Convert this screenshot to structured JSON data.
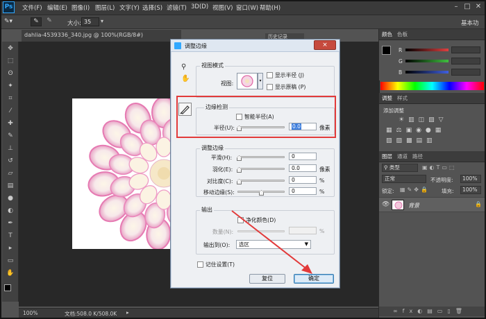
{
  "app": {
    "logo": "Ps"
  },
  "menubar": {
    "items": [
      "文件(F)",
      "编辑(E)",
      "图像(I)",
      "图层(L)",
      "文字(Y)",
      "选择(S)",
      "滤镜(T)",
      "3D(D)",
      "视图(V)",
      "窗口(W)",
      "帮助(H)"
    ]
  },
  "options": {
    "size_label": "大小:",
    "size_value": "35",
    "workspace": "基本功"
  },
  "document": {
    "tab_title": "dahlia-4539336_340.jpg @ 100%(RGB/8#)",
    "history_tab": "历史记录"
  },
  "status": {
    "zoom": "100%",
    "doc_info": "文档:508.0 K/508.0K"
  },
  "color_panel": {
    "tabs": [
      "颜色",
      "色板"
    ],
    "channels": [
      {
        "name": "R",
        "value": "0",
        "color": "#e04040"
      },
      {
        "name": "G",
        "value": "0",
        "color": "#40c040"
      },
      {
        "name": "B",
        "value": "0",
        "color": "#4060e0"
      }
    ]
  },
  "adjust_panel": {
    "tabs": [
      "调整",
      "样式"
    ],
    "add_label": "添加调整"
  },
  "layers_panel": {
    "tabs": [
      "图层",
      "通道",
      "路径"
    ],
    "kind_label": "类型",
    "blend_mode": "正常",
    "opacity_label": "不透明度:",
    "opacity_value": "100%",
    "lock_label": "锁定:",
    "fill_label": "填充:",
    "fill_value": "100%",
    "layer_name": "背景"
  },
  "dialog": {
    "title": "调整边缘",
    "close_icon": "×",
    "view_mode": {
      "group_title": "视图模式",
      "view_label": "视图:",
      "show_radius": "显示半径 (J)",
      "show_original": "显示原稿 (P)"
    },
    "edge_detection": {
      "group_title": "边缘检测",
      "smart_radius": "智能半径(A)",
      "radius_label": "半径(U):",
      "radius_value": "0.0",
      "radius_unit": "像素"
    },
    "adjust_edge": {
      "group_title": "调整边缘",
      "rows": [
        {
          "label": "平滑(H):",
          "value": "0",
          "unit": ""
        },
        {
          "label": "羽化(E):",
          "value": "0.0",
          "unit": "像素"
        },
        {
          "label": "对比度(C):",
          "value": "0",
          "unit": "%"
        },
        {
          "label": "移动边缘(S):",
          "value": "0",
          "unit": "%"
        }
      ]
    },
    "output": {
      "group_title": "输出",
      "decontaminate": "净化颜色(D)",
      "amount_label": "数量(N):",
      "amount_unit": "%",
      "output_to_label": "输出到(O):",
      "output_to_value": "选区"
    },
    "remember_settings": "记住设置(T)",
    "reset_button": "复位",
    "ok_button": "确定"
  },
  "colors": {
    "annotation_red": "#e23a3a",
    "ps_blue": "#31a8ff"
  }
}
